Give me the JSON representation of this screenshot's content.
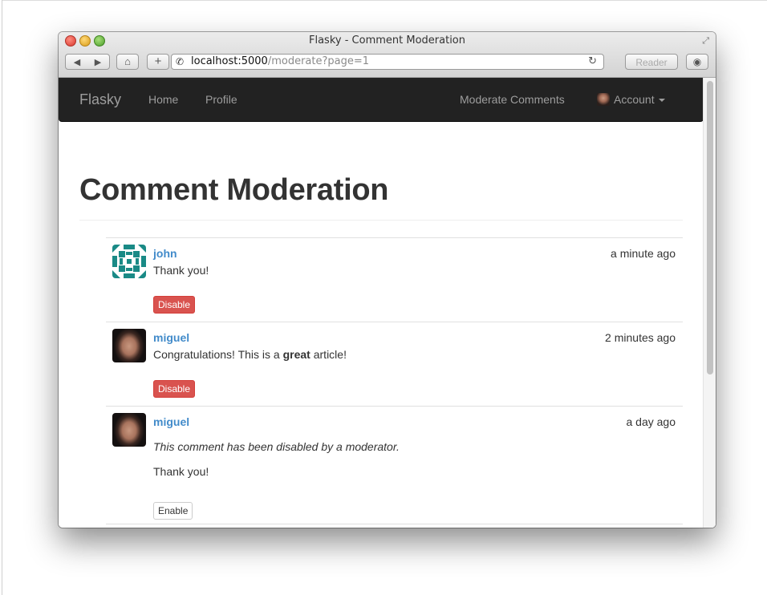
{
  "window": {
    "title": "Flasky - Comment Moderation",
    "url_host": "localhost:5000",
    "url_path": "/moderate?page=1",
    "reader_label": "Reader"
  },
  "navbar": {
    "brand": "Flasky",
    "home": "Home",
    "profile": "Profile",
    "moderate": "Moderate Comments",
    "account": "Account"
  },
  "page": {
    "title": "Comment Moderation"
  },
  "comments": [
    {
      "author": "john",
      "date": "a minute ago",
      "body": "Thank you!",
      "button": "Disable"
    },
    {
      "author": "miguel",
      "date": "2 minutes ago",
      "body_before": "Congratulations! This is a ",
      "body_bold": "great",
      "body_after": " article!",
      "button": "Disable"
    },
    {
      "author": "miguel",
      "date": "a day ago",
      "note": "This comment has been disabled by a moderator.",
      "body": "Thank you!",
      "button": "Enable"
    }
  ],
  "colors": {
    "navbar_bg": "#222222",
    "link": "#428bca",
    "danger": "#d9534f",
    "identicon": "#1a8a86"
  }
}
